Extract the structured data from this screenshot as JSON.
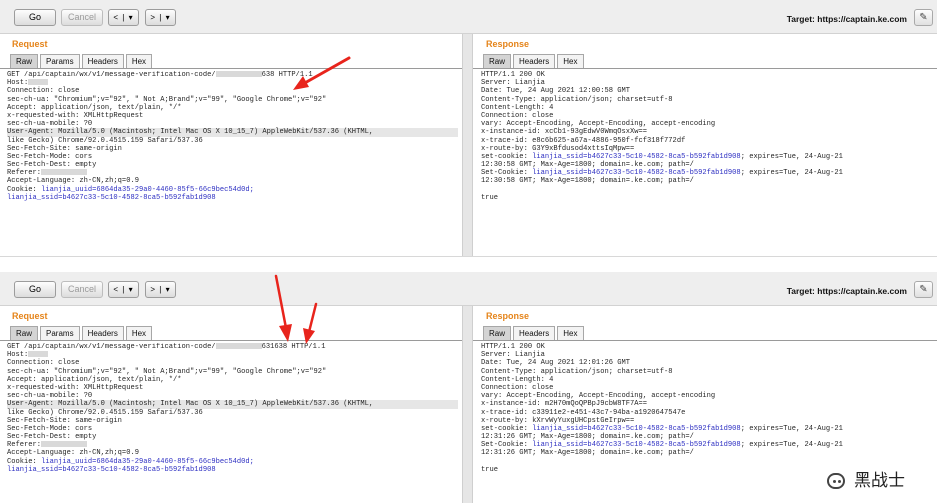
{
  "toolbar": {
    "go_label": "Go",
    "cancel_label": "Cancel",
    "back_glyph": "< | ▾",
    "forward_glyph": "> | ▾",
    "target_label": "Target:",
    "target_url": "https://captain.ke.com",
    "edit_icon": "pencil-icon"
  },
  "request_title": "Request",
  "response_title": "Response",
  "request_tabs": [
    "Raw",
    "Params",
    "Headers",
    "Hex"
  ],
  "response_tabs": [
    "Raw",
    "Headers",
    "Hex"
  ],
  "screen1": {
    "request_lines": [
      {
        "t": "GET /api/captain/wx/v1/message-verification-code/",
        "r": true,
        "t2": "638 HTTP/1.1"
      },
      {
        "t": "Host:",
        "r": true,
        "short": true
      },
      {
        "t": "Connection: close"
      },
      {
        "t": "sec-ch-ua: \"Chromium\";v=\"92\", \" Not A;Brand\";v=\"99\", \"Google Chrome\";v=\"92\""
      },
      {
        "t": "Accept: application/json, text/plain, */*"
      },
      {
        "t": "x-requested-with: XMLHttpRequest"
      },
      {
        "t": "sec-ch-ua-mobile: ?0"
      },
      {
        "t": "User-Agent: Mozilla/5.0 (Macintosh; Intel Mac OS X 10_15_7) AppleWebKit/537.36 (KHTML,",
        "hl": true
      },
      {
        "t": "like Gecko) Chrome/92.0.4515.159 Safari/537.36"
      },
      {
        "t": "Sec-Fetch-Site: same-origin"
      },
      {
        "t": "Sec-Fetch-Mode: cors"
      },
      {
        "t": "Sec-Fetch-Dest: empty"
      },
      {
        "t": "Referer:",
        "r": true
      },
      {
        "t": "Accept-Language: zh-CN,zh;q=0.9"
      },
      {
        "t": "Cookie: ",
        "b": "lianjia_uuid=6864da35-29a0-4460-85f5-66c9bec54d0d;"
      },
      {
        "t": "",
        "b": "lianjia_ssid=b4627c33-5c10-4582-8ca5-b592fab1d908"
      }
    ],
    "response_lines": [
      {
        "t": "HTTP/1.1 200 OK"
      },
      {
        "t": "Server: Lianjia"
      },
      {
        "t": "Date: Tue, 24 Aug 2021 12:00:58 GMT"
      },
      {
        "t": "Content-Type: application/json; charset=utf-8"
      },
      {
        "t": "Content-Length: 4"
      },
      {
        "t": "Connection: close"
      },
      {
        "t": "vary: Accept-Encoding, Accept-Encoding, accept-encoding"
      },
      {
        "t": "x-instance-id: xcCb1-93gEdwV0WmqOsxXw=="
      },
      {
        "t": "x-trace-id: e8c6b625-a67a-4886-950f-fcf318f772df"
      },
      {
        "t": "x-route-by: G3Y9xBfdusod4xttsIqMpw=="
      },
      {
        "t": "set-cookie: ",
        "b": "lianjia_ssid=b4627c33-5c10-4582-8ca5-b592fab1d908",
        "t2": "; expires=Tue, 24-Aug-21"
      },
      {
        "t": "12:30:58 GMT; Max-Age=1800; domain=.ke.com; path=/"
      },
      {
        "t": "Set-Cookie: ",
        "b": "lianjia_ssid=b4627c33-5c10-4582-8ca5-b592fab1d908",
        "t2": "; expires=Tue, 24-Aug-21"
      },
      {
        "t": "12:30:58 GMT; Max-Age=1800; domain=.ke.com; path=/"
      },
      {
        "t": ""
      },
      {
        "t": "true"
      }
    ]
  },
  "screen2": {
    "request_lines": [
      {
        "t": "GET /api/captain/wx/v1/message-verification-code/",
        "r": true,
        "t2": "631638 HTTP/1.1"
      },
      {
        "t": "Host:",
        "r": true,
        "short": true
      },
      {
        "t": "Connection: close"
      },
      {
        "t": "sec-ch-ua: \"Chromium\";v=\"92\", \" Not A;Brand\";v=\"99\", \"Google Chrome\";v=\"92\""
      },
      {
        "t": "Accept: application/json, text/plain, */*"
      },
      {
        "t": "x-requested-with: XMLHttpRequest"
      },
      {
        "t": "sec-ch-ua-mobile: ?0"
      },
      {
        "t": "User-Agent: Mozilla/5.0 (Macintosh; Intel Mac OS X 10_15_7) AppleWebKit/537.36 (KHTML,",
        "hl": true
      },
      {
        "t": "like Gecko) Chrome/92.0.4515.159 Safari/537.36"
      },
      {
        "t": "Sec-Fetch-Site: same-origin"
      },
      {
        "t": "Sec-Fetch-Mode: cors"
      },
      {
        "t": "Sec-Fetch-Dest: empty"
      },
      {
        "t": "Referer:",
        "r": true
      },
      {
        "t": "Accept-Language: zh-CN,zh;q=0.9"
      },
      {
        "t": "Cookie: ",
        "b": "lianjia_uuid=6864da35-29a0-4460-85f5-66c9bec54d0d;"
      },
      {
        "t": "",
        "b": "lianjia_ssid=b4627c33-5c10-4582-8ca5-b592fab1d908"
      }
    ],
    "response_lines": [
      {
        "t": "HTTP/1.1 200 OK"
      },
      {
        "t": "Server: Lianjia"
      },
      {
        "t": "Date: Tue, 24 Aug 2021 12:01:26 GMT"
      },
      {
        "t": "Content-Type: application/json; charset=utf-8"
      },
      {
        "t": "Content-Length: 4"
      },
      {
        "t": "Connection: close"
      },
      {
        "t": "vary: Accept-Encoding, Accept-Encoding, accept-encoding"
      },
      {
        "t": "x-instance-id: m2H70mQoQPBpJ9cbW8TF7A=="
      },
      {
        "t": "x-trace-id: c33911e2-e451-43c7-94ba-a1920647547e"
      },
      {
        "t": "x-route-by: kXrvWyYuxgUHCpstGeIrpw=="
      },
      {
        "t": "set-cookie: ",
        "b": "lianjia_ssid=b4627c33-5c10-4582-8ca5-b592fab1d908",
        "t2": "; expires=Tue, 24-Aug-21"
      },
      {
        "t": "12:31:26 GMT; Max-Age=1800; domain=.ke.com; path=/"
      },
      {
        "t": "Set-Cookie: ",
        "b": "lianjia_ssid=b4627c33-5c10-4582-8ca5-b592fab1d908",
        "t2": "; expires=Tue, 24-Aug-21"
      },
      {
        "t": "12:31:26 GMT; Max-Age=1800; domain=.ke.com; path=/"
      },
      {
        "t": ""
      },
      {
        "t": "true"
      }
    ]
  },
  "watermark": "黑战士",
  "colors": {
    "accent": "#e5841a",
    "cookie": "#2d2fc2",
    "annotation": "#e8241c"
  }
}
